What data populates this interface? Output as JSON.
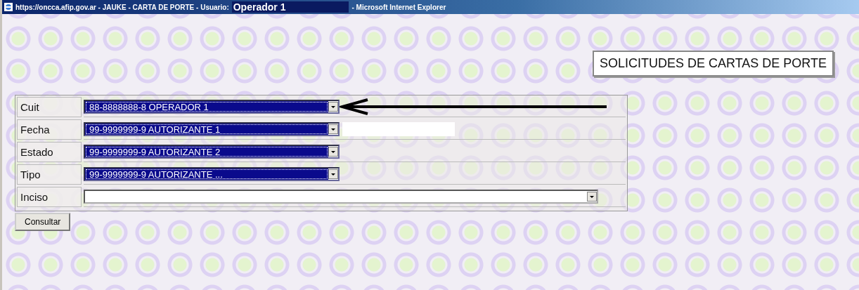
{
  "window": {
    "title_parts": [
      {
        "text": "https://oncca.afip.gov.ar - JAUKE - CARTA DE PORTE - Usuario: "
      },
      {
        "text": "Operador 1",
        "kind": "user"
      },
      {
        "text": "- Microsoft Internet Explorer"
      }
    ]
  },
  "heading": "SOLICITUDES DE CARTAS DE PORTE",
  "form_rows": [
    {
      "label": "Cuit",
      "select": {
        "value": "88-8888888-8 OPERADOR 1",
        "selected": true,
        "wide": false
      },
      "arrow": true
    },
    {
      "label": "Fecha",
      "select": {
        "value": "99-9999999-9 AUTORIZANTE 1",
        "selected": true,
        "wide": false
      },
      "input": true
    },
    {
      "label": "Estado",
      "select": {
        "value": "99-9999999-9 AUTORIZANTE 2",
        "selected": true,
        "wide": false
      }
    },
    {
      "label": "Tipo",
      "select": {
        "value": "99-9999999-9 AUTORIZANTE ...",
        "selected": true,
        "wide": false
      }
    },
    {
      "label": "Inciso",
      "select": {
        "selected": false,
        "wide": true
      }
    }
  ],
  "submit_button": "Consultar"
}
